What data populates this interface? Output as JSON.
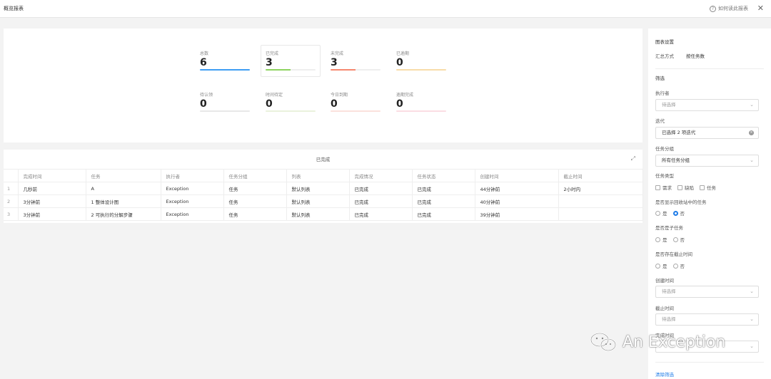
{
  "header": {
    "title": "概览报表",
    "help_label": "如何读此报表",
    "help_glyph": "?",
    "close_glyph": "✕"
  },
  "summary": {
    "stats": [
      {
        "label": "总数",
        "value": "6",
        "color": "#3f9df3",
        "fill": 1.0
      },
      {
        "label": "已完成",
        "value": "3",
        "color": "#8dd35f",
        "fill": 0.5
      },
      {
        "label": "未完成",
        "value": "3",
        "color": "#f5886f",
        "fill": 0.5
      },
      {
        "label": "已逾期",
        "value": "0",
        "color": "#f8dca9",
        "fill": 0
      },
      {
        "label": "待认领",
        "value": "0",
        "color": "#e8e8e8",
        "fill": 0
      },
      {
        "label": "时间待定",
        "value": "0",
        "color": "#eaf2dc",
        "fill": 0
      },
      {
        "label": "今日到期",
        "value": "0",
        "color": "#fbe1dc",
        "fill": 0
      },
      {
        "label": "逾期完成",
        "value": "0",
        "color": "#fbdde3",
        "fill": 0
      }
    ]
  },
  "table": {
    "caption": "已完成",
    "expand_glyph": "⤢",
    "columns": [
      "完成时间",
      "任务",
      "执行者",
      "任务分组",
      "列表",
      "完成情况",
      "任务状态",
      "创建时间",
      "截止时间"
    ],
    "rows": [
      {
        "index": "1",
        "cells": [
          "几秒前",
          "A",
          "Exception",
          "任务",
          "默认列表",
          "已完成",
          "已完成",
          "44分钟前",
          "2小时内"
        ]
      },
      {
        "index": "2",
        "cells": [
          "3分钟前",
          "1 整体设计图",
          "Exception",
          "任务",
          "默认列表",
          "已完成",
          "已完成",
          "40分钟前",
          ""
        ]
      },
      {
        "index": "3",
        "cells": [
          "3分钟前",
          "2 可执行的分解步骤",
          "Exception",
          "任务",
          "默认列表",
          "已完成",
          "已完成",
          "39分钟前",
          ""
        ]
      }
    ]
  },
  "sidebar": {
    "chart_settings_title": "图表设置",
    "summary_mode_label": "汇总方式",
    "summary_mode_value": "按任务数",
    "filter_title": "筛选",
    "assignee_label": "执行者",
    "assignee_placeholder": "待选择",
    "iteration_label": "迭代",
    "iteration_value": "已选择 2 项迭代",
    "group_label": "任务分组",
    "group_value": "所有任务分组",
    "type_label": "任务类型",
    "type_options": [
      "需求",
      "缺陷",
      "任务"
    ],
    "recycle_label": "是否显示回收站中的任务",
    "recycle_options": [
      "是",
      "否"
    ],
    "subtask_label": "是否是子任务",
    "subtask_options": [
      "是",
      "否"
    ],
    "deadline_exists_label": "是否存在截止时间",
    "deadline_exists_options": [
      "是",
      "否"
    ],
    "created_label": "创建时间",
    "created_placeholder": "待选择",
    "due_label": "截止时间",
    "due_placeholder": "待选择",
    "completed_label": "完成时间",
    "clear_link": "清除筛选",
    "chevron_glyph": "⌄",
    "clear_glyph": "×"
  },
  "watermark": {
    "text": "An Exception"
  }
}
